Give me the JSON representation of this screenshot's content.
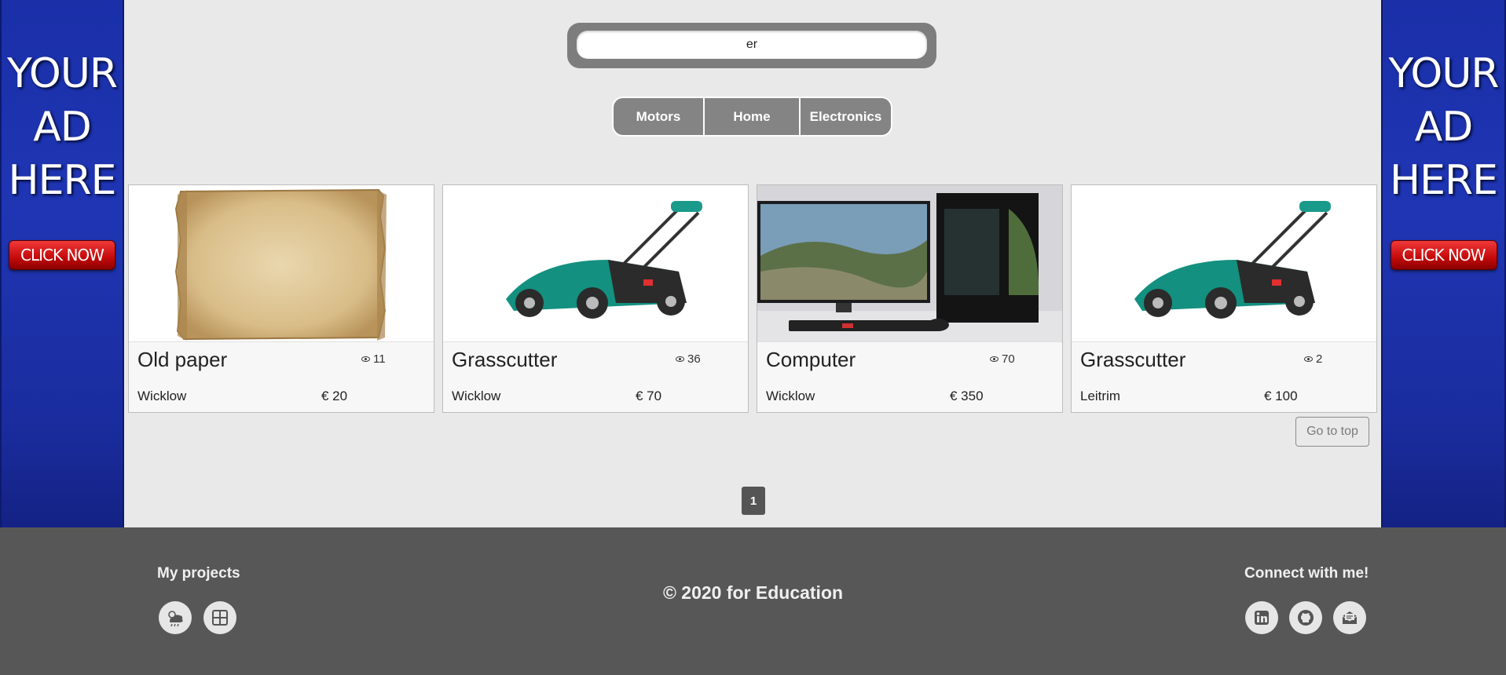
{
  "ads": {
    "left": {
      "line1": "YOUR",
      "line2": "AD",
      "line3": "HERE",
      "button": "CLICK NOW"
    },
    "right": {
      "line1": "YOUR",
      "line2": "AD",
      "line3": "HERE",
      "button": "CLICK NOW"
    }
  },
  "search": {
    "value": "er"
  },
  "categories": [
    "Motors",
    "Home",
    "Electronics"
  ],
  "listings": [
    {
      "title": "Old paper",
      "views": "11",
      "location": "Wicklow",
      "price": "€ 20",
      "image": "old-paper"
    },
    {
      "title": "Grasscutter",
      "views": "36",
      "location": "Wicklow",
      "price": "€ 70",
      "image": "lawn-mower"
    },
    {
      "title": "Computer",
      "views": "70",
      "location": "Wicklow",
      "price": "€ 350",
      "image": "computer"
    },
    {
      "title": "Grasscutter",
      "views": "2",
      "location": "Leitrim",
      "price": "€ 100",
      "image": "lawn-mower"
    }
  ],
  "go_to_top": "Go to top",
  "pagination": {
    "current": "1"
  },
  "footer": {
    "projects_title": "My projects",
    "copyright": "© 2020 for Education",
    "connect_title": "Connect with me!",
    "project_icons": [
      "weather-icon",
      "grid-app-icon"
    ],
    "social_icons": [
      "linkedin-icon",
      "github-icon",
      "mail-icon"
    ]
  },
  "colors": {
    "ad_blue": "#1f35b3",
    "ad_button_red": "#c40a0a",
    "category_gray": "#848484",
    "footer_bg": "#575757",
    "page_bg": "#e9e9e9"
  }
}
